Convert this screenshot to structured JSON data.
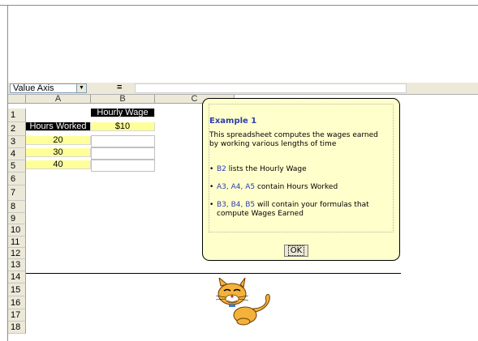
{
  "namebox": {
    "value": "Value Axis"
  },
  "formula": {
    "equals_sign": "="
  },
  "columns": [
    "A",
    "B",
    "C"
  ],
  "rows": [
    "1",
    "2",
    "3",
    "4",
    "5",
    "6",
    "7",
    "8",
    "9",
    "10",
    "11",
    "12",
    "13",
    "14",
    "15",
    "16",
    "17",
    "18"
  ],
  "sheet": {
    "header_b1": "Hourly Wage",
    "label_a2": "Hours Worked",
    "wage_b2": "$10",
    "hours": [
      "20",
      "30",
      "40"
    ]
  },
  "callout": {
    "title": "Example 1",
    "description": "This spreadsheet computes the wages earned by working various lengths of time",
    "bullets": [
      {
        "ref": "B2",
        "text": " lists the Hourly Wage"
      },
      {
        "ref": "A3, A4, A5",
        "text": " contain Hours Worked"
      },
      {
        "ref": "B3, B4, B5",
        "text": " will contain your formulas that compute Wages Earned"
      }
    ],
    "bullet_char": "•",
    "ok_label": "OK"
  },
  "colors": {
    "callout_bg": "#ffffcc",
    "yellow_cell": "#ffff99",
    "header_black": "#000000",
    "link_blue": "#2d3db0"
  },
  "icons": {
    "assistant": "cat-assistant-icon"
  }
}
